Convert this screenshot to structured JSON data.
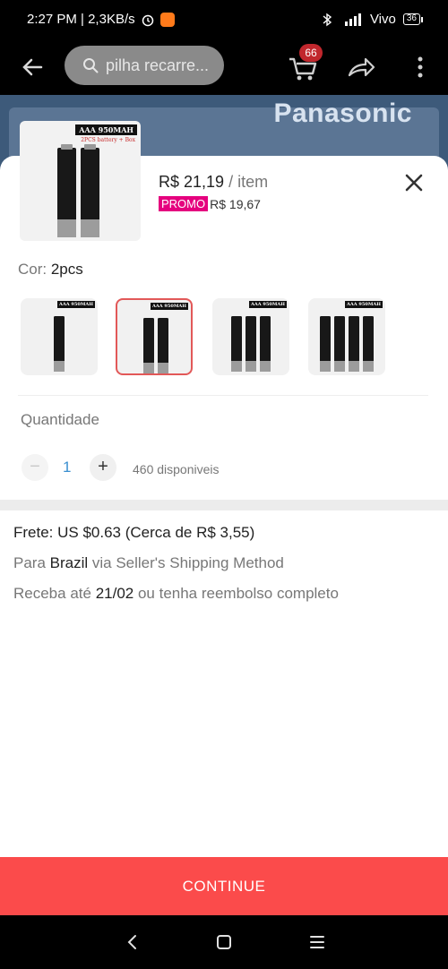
{
  "status_bar": {
    "time_speed": "2:27 PM | 2,3KB/s",
    "carrier": "Vivo",
    "battery": "36"
  },
  "header": {
    "search_text": "pilha recarre...",
    "cart_count": "66"
  },
  "banner": {
    "brand": "Panasonic"
  },
  "product": {
    "thumb_label": "AAA 950MAH",
    "thumb_sub": "2PCS battery + Box",
    "price": "R$ 21,19",
    "price_unit": " / item",
    "promo_badge": "PROMO",
    "promo_price": "R$ 19,67"
  },
  "color": {
    "label": "Cor: ",
    "value": "2pcs",
    "variants": [
      {
        "label": "AAA 950MAH",
        "count": 1
      },
      {
        "label": "AAA 950MAH",
        "count": 2
      },
      {
        "label": "AAA 950MAH",
        "count": 3
      },
      {
        "label": "AAA 950MAH",
        "count": 4
      }
    ],
    "selected_index": 1
  },
  "quantity": {
    "label": "Quantidade",
    "minus": "−",
    "value": "1",
    "plus": "+",
    "stock": "460 disponiveis"
  },
  "shipping": {
    "fee": "Frete: US $0.63 (Cerca de R$ 3,55)",
    "dest_prefix": "Para ",
    "dest_country": "Brazil",
    "dest_suffix": " via Seller's Shipping Method",
    "delivery_prefix": "Receba até ",
    "delivery_date": "21/02",
    "delivery_suffix": " ou tenha reembolso completo"
  },
  "cta": {
    "continue_label": "CONTINUE"
  },
  "colors": {
    "accent_red": "#fb4b4b",
    "promo_pink": "#e5007e",
    "qty_blue": "#3a8fd0"
  }
}
